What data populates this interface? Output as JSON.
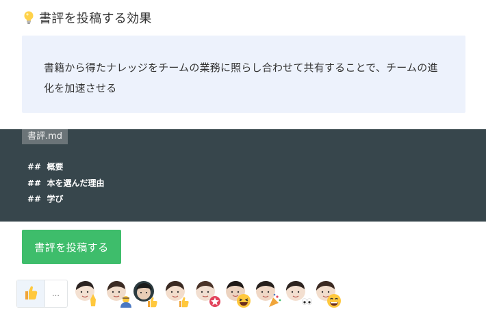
{
  "section": {
    "heading": "書評を投稿する効果",
    "icon": "lightbulb-icon"
  },
  "note": {
    "text": "書籍から得たナレッジをチームの業務に照らし合わせて共有することで、チームの進化を加速させる"
  },
  "code_block": {
    "filename": "書評.md",
    "lines": [
      "##  概要",
      "##  本を選んだ理由",
      "##  学び"
    ]
  },
  "submit_button": {
    "label": "書評を投稿する"
  },
  "reactions": {
    "more_label": "…",
    "like_icon": "thumbs-up-icon",
    "avatars": [
      {
        "name": "avatar-1",
        "reaction": "pray-icon"
      },
      {
        "name": "avatar-2",
        "reaction": "worker-icon"
      },
      {
        "name": "avatar-3",
        "reaction": "thumbs-up-icon"
      },
      {
        "name": "avatar-4",
        "reaction": "thumbs-up-icon"
      },
      {
        "name": "avatar-5",
        "reaction": "sparkle-icon"
      },
      {
        "name": "avatar-6",
        "reaction": "laughing-icon"
      },
      {
        "name": "avatar-7",
        "reaction": "party-popper-icon"
      },
      {
        "name": "avatar-8",
        "reaction": "eyes-icon"
      },
      {
        "name": "avatar-9",
        "reaction": "smile-icon"
      }
    ]
  },
  "colors": {
    "note_bg": "#edf2fc",
    "code_bg": "#37464c",
    "button_bg": "#3ebd6b"
  }
}
